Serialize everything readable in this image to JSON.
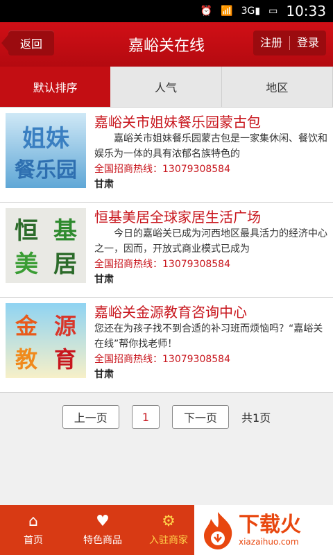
{
  "status_bar": {
    "time": "10:33",
    "network": "3G",
    "icons": [
      "alarm-icon",
      "wifi-icon",
      "signal-icon",
      "battery-icon"
    ]
  },
  "header": {
    "back_label": "返回",
    "title": "嘉峪关在线",
    "register_label": "注册",
    "login_label": "登录"
  },
  "tabs": [
    {
      "label": "默认排序"
    },
    {
      "label": "人气"
    },
    {
      "label": "地区"
    }
  ],
  "items": [
    {
      "thumb_text": "姐妹餐乐园",
      "name": "嘉峪关市姐妹餐乐园蒙古包",
      "desc": "嘉峪关市姐妹餐乐园蒙古包是一家集休闲、餐饮和娱乐为一体的具有浓郁名族特色的",
      "phone": "全国招商热线：13079308584",
      "region": "甘肃"
    },
    {
      "thumb_text": "恒基美居",
      "name": "恒基美居全球家居生活广场",
      "desc": "今日的嘉峪关已成为河西地区最具活力的经济中心之一，因而，开放式商业模式已成为",
      "phone": "全国招商热线：13079308584",
      "region": "甘肃"
    },
    {
      "thumb_text": "金源教育",
      "name": "嘉峪关金源教育咨询中心",
      "desc": "您还在为孩子找不到合适的补习班而烦恼吗？“嘉峪关在线”帮你找老师！",
      "phone": "全国招商热线：13079308584",
      "region": "甘肃"
    }
  ],
  "pager": {
    "prev": "上一页",
    "current": "1",
    "next": "下一页",
    "total": "共1页"
  },
  "bottom_nav": [
    {
      "label": "首页",
      "icon": "home-icon"
    },
    {
      "label": "特色商品",
      "icon": "heart-icon"
    },
    {
      "label": "入驻商家",
      "icon": "gear-icon"
    }
  ],
  "watermark": {
    "main": "下载火",
    "sub": "xiazaihuo.com"
  },
  "colors": {
    "brand_red": "#c30e13",
    "bottom_bar": "#d83a14",
    "active_yellow": "#ffd24a"
  }
}
